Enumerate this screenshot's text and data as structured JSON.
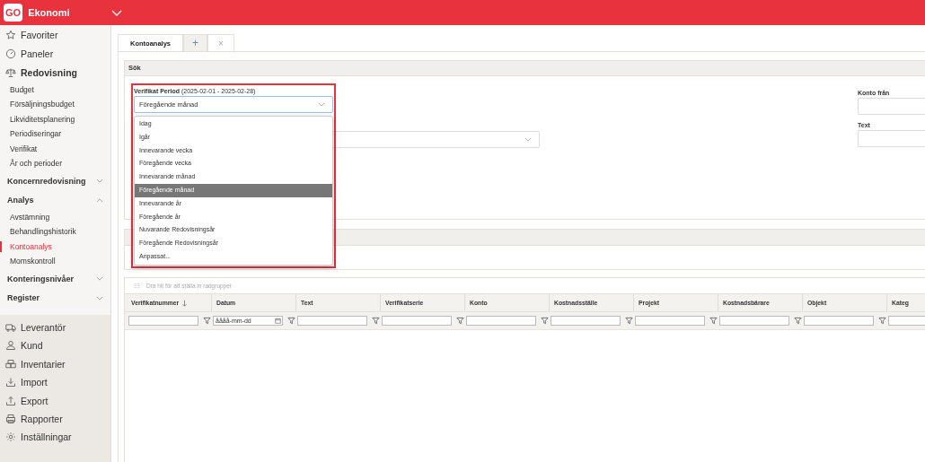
{
  "header": {
    "logo": "GO",
    "app": "Ekonomi"
  },
  "sidebar": {
    "items": [
      {
        "kind": "main",
        "label": "Favoriter"
      },
      {
        "kind": "main",
        "label": "Paneler"
      },
      {
        "kind": "section",
        "label": "Redovisning",
        "children": [
          {
            "label": "Budget",
            "selected": false
          },
          {
            "label": "Försäljningsbudget",
            "selected": false
          },
          {
            "label": "Likviditetsplanering",
            "selected": false
          },
          {
            "label": "Periodiseringar",
            "selected": false
          },
          {
            "label": "Verifikat",
            "selected": false
          },
          {
            "label": "År och perioder",
            "selected": false
          }
        ]
      },
      {
        "kind": "group",
        "label": "Koncernredovisning",
        "expanded": false
      },
      {
        "kind": "group",
        "label": "Analys",
        "expanded": true,
        "children": [
          {
            "label": "Avstämning",
            "selected": false
          },
          {
            "label": "Behandlingshistorik",
            "selected": false
          },
          {
            "label": "Kontoanalys",
            "selected": true
          },
          {
            "label": "Momskontroll",
            "selected": false
          }
        ]
      },
      {
        "kind": "group",
        "label": "Konteringsnivåer",
        "expanded": false
      },
      {
        "kind": "group",
        "label": "Register",
        "expanded": false
      }
    ],
    "bottom": [
      {
        "label": "Leverantör"
      },
      {
        "label": "Kund"
      },
      {
        "label": "Inventarier"
      },
      {
        "label": "Import"
      },
      {
        "label": "Export"
      },
      {
        "label": "Rapporter"
      },
      {
        "label": "Inställningar"
      }
    ]
  },
  "tabs": [
    {
      "kind": "tab",
      "label": "Kontoanalys",
      "selected": true
    },
    {
      "kind": "add",
      "label": "+"
    },
    {
      "kind": "close",
      "label": "×"
    }
  ],
  "search": {
    "title": "Sök",
    "period": {
      "label": "Verifikat Period",
      "range": "(2025-02-01 - 2025-02-28)",
      "value": "Föregående månad",
      "highlighted": true,
      "open": true,
      "options": [
        {
          "label": "Idag",
          "selected": false
        },
        {
          "label": "Igår",
          "selected": false
        },
        {
          "label": "Innevarande vecka",
          "selected": false
        },
        {
          "label": "Föregående vecka",
          "selected": false
        },
        {
          "label": "Innevarande månad",
          "selected": false
        },
        {
          "label": "Föregående månad",
          "selected": true
        },
        {
          "label": "Innevarande år",
          "selected": false
        },
        {
          "label": "Föregående år",
          "selected": false
        },
        {
          "label": "Nuvarande Redovisningsår",
          "selected": false
        },
        {
          "label": "Föregående Redovisningsår",
          "selected": false
        },
        {
          "label": "Anpassat...",
          "selected": false
        }
      ]
    },
    "right_fields": [
      {
        "label": "Konto från"
      },
      {
        "label": "Text"
      }
    ]
  },
  "grid": {
    "group_hint": "Dra hit för att ställa in radgrupper",
    "columns": [
      {
        "label": "Verifikatnummer",
        "sorted": true,
        "kind": "text"
      },
      {
        "label": "Datum",
        "sorted": false,
        "kind": "date",
        "placeholder": "åååå-mm-dd"
      },
      {
        "label": "Text",
        "sorted": false,
        "kind": "text"
      },
      {
        "label": "Verifikatserie",
        "sorted": false,
        "kind": "text"
      },
      {
        "label": "Konto",
        "sorted": false,
        "kind": "text"
      },
      {
        "label": "Kostnadsställe",
        "sorted": false,
        "kind": "text"
      },
      {
        "label": "Projekt",
        "sorted": false,
        "kind": "text"
      },
      {
        "label": "Kostnadsbärare",
        "sorted": false,
        "kind": "text"
      },
      {
        "label": "Objekt",
        "sorted": false,
        "kind": "text"
      },
      {
        "label": "Kateg",
        "sorted": false,
        "kind": "text"
      }
    ]
  }
}
